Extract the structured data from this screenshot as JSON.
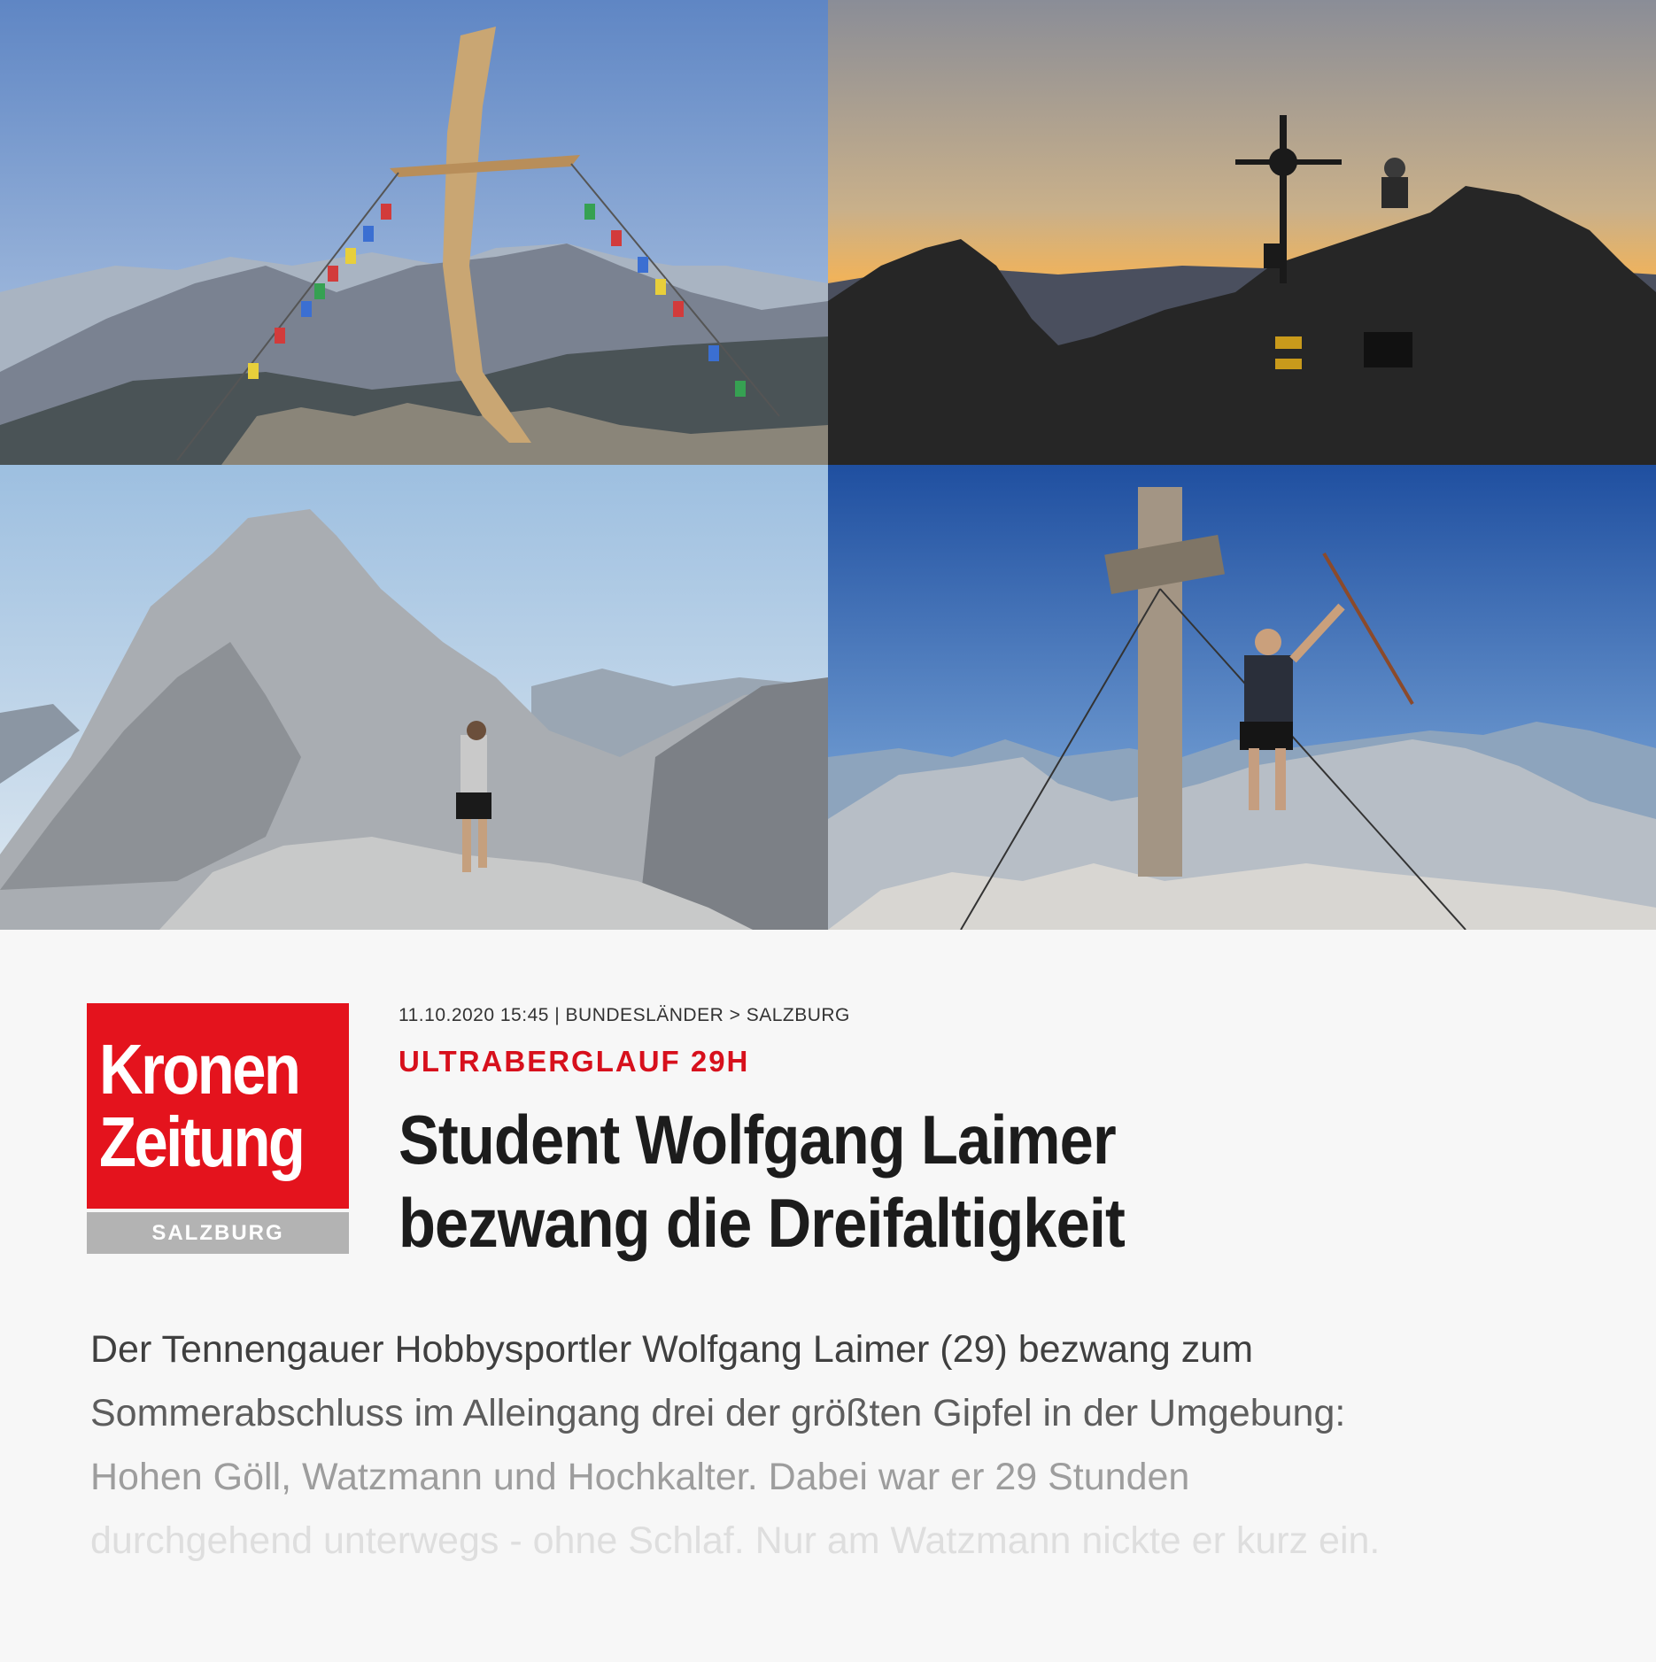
{
  "photos": [
    {
      "name": "summit-cross-prayer-flags"
    },
    {
      "name": "summit-cross-sunset"
    },
    {
      "name": "climber-on-ridge"
    },
    {
      "name": "hiker-at-summit-cross"
    }
  ],
  "logo": {
    "line1": "Kronen",
    "line2": "Zeitung",
    "region": "SALZBURG",
    "colors": {
      "red": "#e4131d",
      "band": "#b3b3b3"
    }
  },
  "article": {
    "meta": "11.10.2020 15:45 | BUNDESLÄNDER > SALZBURG",
    "kicker": "ULTRABERGLAUF 29H",
    "headline": [
      "Student Wolfgang Laimer",
      "bezwang die Dreifaltigkeit"
    ],
    "lead": [
      "Der Tennengauer Hobbysportler Wolfgang Laimer (29) bezwang zum",
      "Sommerabschluss im Alleingang drei der größten Gipfel in der Umgebung:",
      "Hohen Göll, Watzmann und Hochkalter. Dabei war er 29 Stunden",
      "durchgehend unterwegs - ohne Schlaf. Nur am Watzmann nickte er kurz ein."
    ],
    "colors": {
      "kicker": "#d7101c",
      "headline": "#1c1c1c"
    }
  }
}
